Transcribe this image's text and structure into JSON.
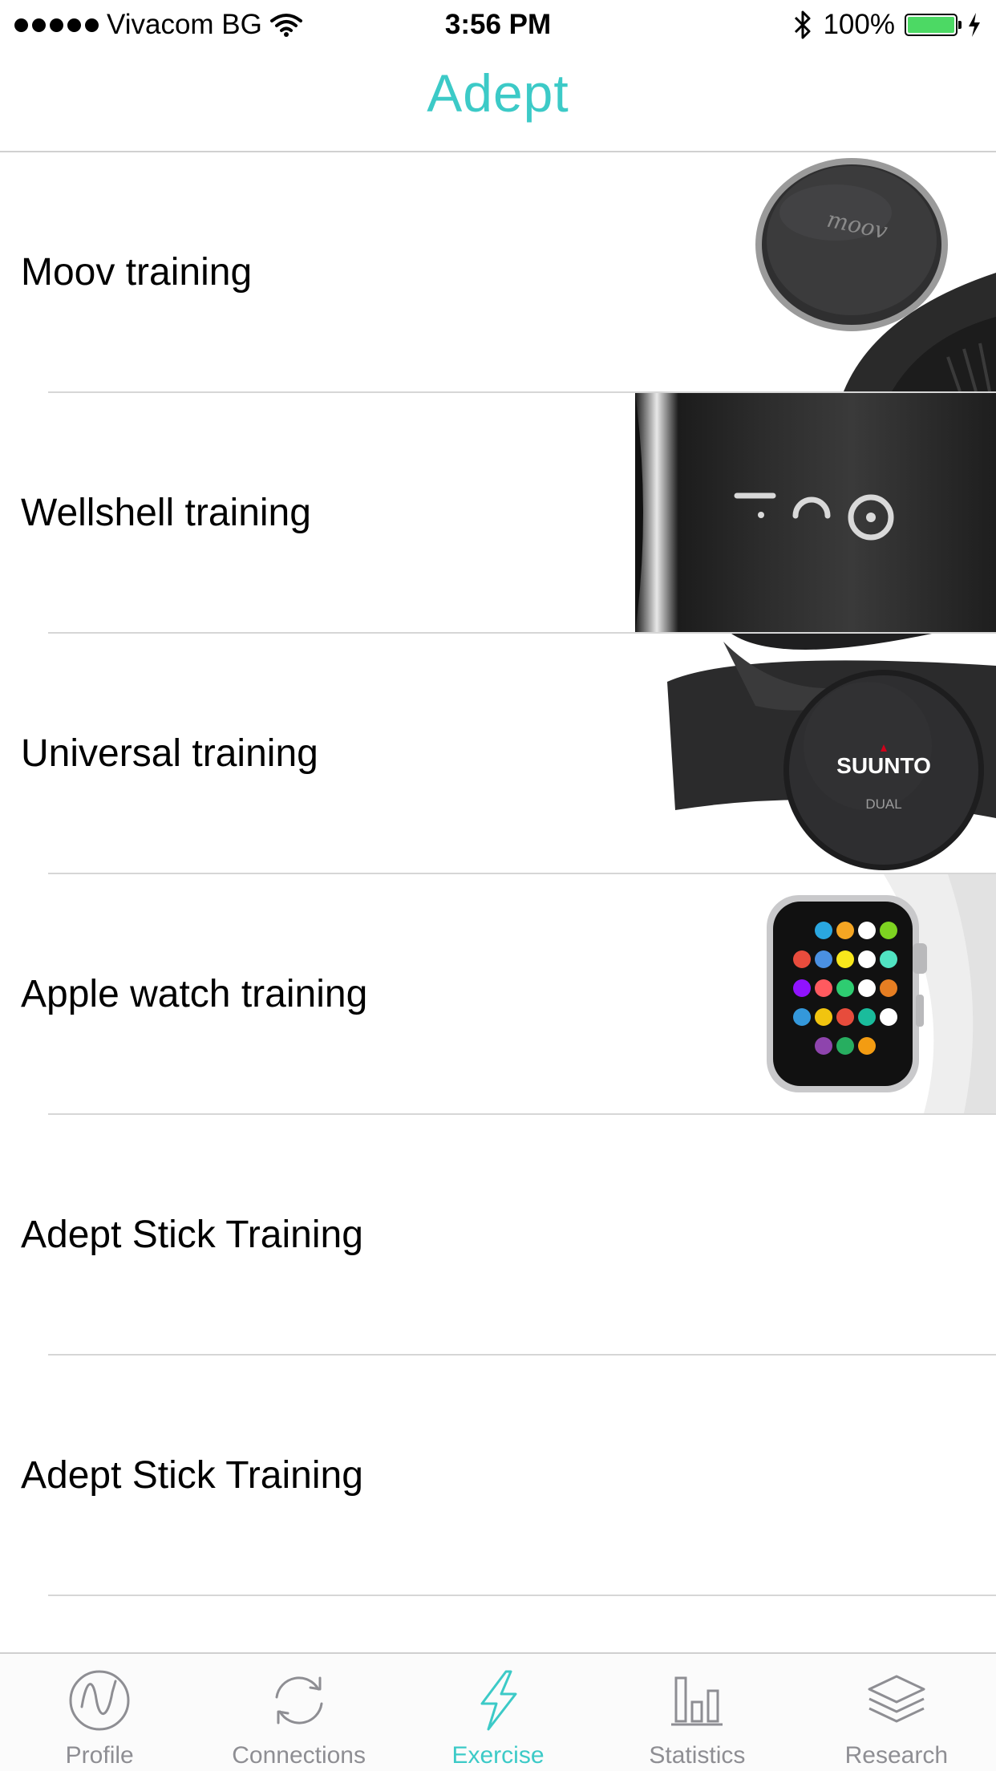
{
  "status_bar": {
    "carrier": "Vivacom BG",
    "time": "3:56 PM",
    "battery": "100%",
    "battery_level": 1.0
  },
  "nav": {
    "title": "Adept",
    "accent_color": "#3ccac7"
  },
  "list": {
    "items": [
      {
        "label": "Moov training",
        "image": "moov-device"
      },
      {
        "label": "Wellshell training",
        "image": "wellshell-device"
      },
      {
        "label": "Universal training",
        "image": "suunto-heart-strap",
        "brand": "SUUNTO",
        "model": "DUAL"
      },
      {
        "label": "Apple watch training",
        "image": "apple-watch"
      },
      {
        "label": "Adept Stick Training",
        "image": ""
      },
      {
        "label": "Adept Stick Training",
        "image": ""
      }
    ]
  },
  "tab_bar": {
    "tabs": [
      {
        "label": "Profile",
        "icon": "wave-circle-icon"
      },
      {
        "label": "Connections",
        "icon": "sync-icon"
      },
      {
        "label": "Exercise",
        "icon": "lightning-icon",
        "active": true
      },
      {
        "label": "Statistics",
        "icon": "bar-chart-icon"
      },
      {
        "label": "Research",
        "icon": "layers-icon"
      }
    ]
  }
}
